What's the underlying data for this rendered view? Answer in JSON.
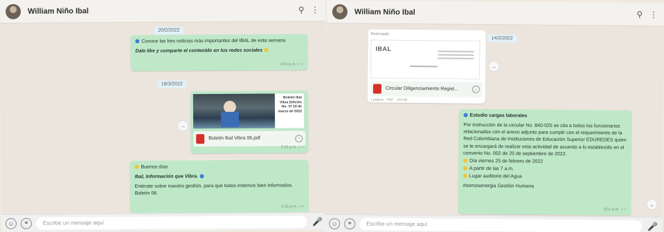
{
  "left": {
    "header": {
      "title": "William Niño Ibal"
    },
    "date_1": "20/2/2022",
    "bubble_1": {
      "line_1": "Conoce las tres noticias más importantes del IBAL de esta semana",
      "line_2": "Dale like y comparte el contenido en tus redes sociales",
      "time": "4:01 p.m. ✓✓"
    },
    "date_2": "18/3/2022",
    "bubble_2": {
      "caption": "Boletín Ibal Vibra Edición No. 37 18 de marzo de 2022",
      "file": "Boletín Ibal Vibra 06.pdf",
      "time": "3:15 p.m. ✓✓"
    },
    "bubble_3": {
      "greeting": "Buenos días",
      "title": "Ibal, Información que Vibra.",
      "body": "Entérate sobre nuestra gestión, para que todos estemos bien informados. Boletín 06",
      "time": "3:15 p.m. ✓✓"
    },
    "footer": {
      "placeholder": "Escribe un mensaje aquí"
    }
  },
  "right": {
    "header": {
      "title": "William Niño Ibal"
    },
    "date_1": "14/2/2022",
    "forward_label": "Reenviado",
    "doc_file": "Circular Diligenciamiento Regist...",
    "doc_meta": "1 página · PDF · 124 kB",
    "bubble": {
      "title": "Estudio cargas laborales",
      "body": "Por instrucción de la circular No. 840-025 se cita a todos los funcionarios relacionados con el anexo adjunto para cumplir con el requerimiento de la Red Colombiana de Instituciones de Educación Superior EDUREDES quien se le encargará de realizar esta actividad de acuerdo a lo establecido en el convenio No. 002 de 25 de septiembre de 2022.",
      "item_1": "Día viernes 25 de febrero de 2022",
      "item_2": "A partir de las 7 a.m.",
      "item_3": "Lugar auditorio del Agua",
      "footer": "#somosenergia Gestión Humana",
      "time": "3:01 p.m. ✓✓"
    },
    "footer": {
      "placeholder": "Escribe un mensaje aquí"
    }
  },
  "colors": {
    "outgoing_bubble": "#bfe8c9",
    "chat_bg": "#ece5dd",
    "pdf_icon": "#d6302b"
  }
}
